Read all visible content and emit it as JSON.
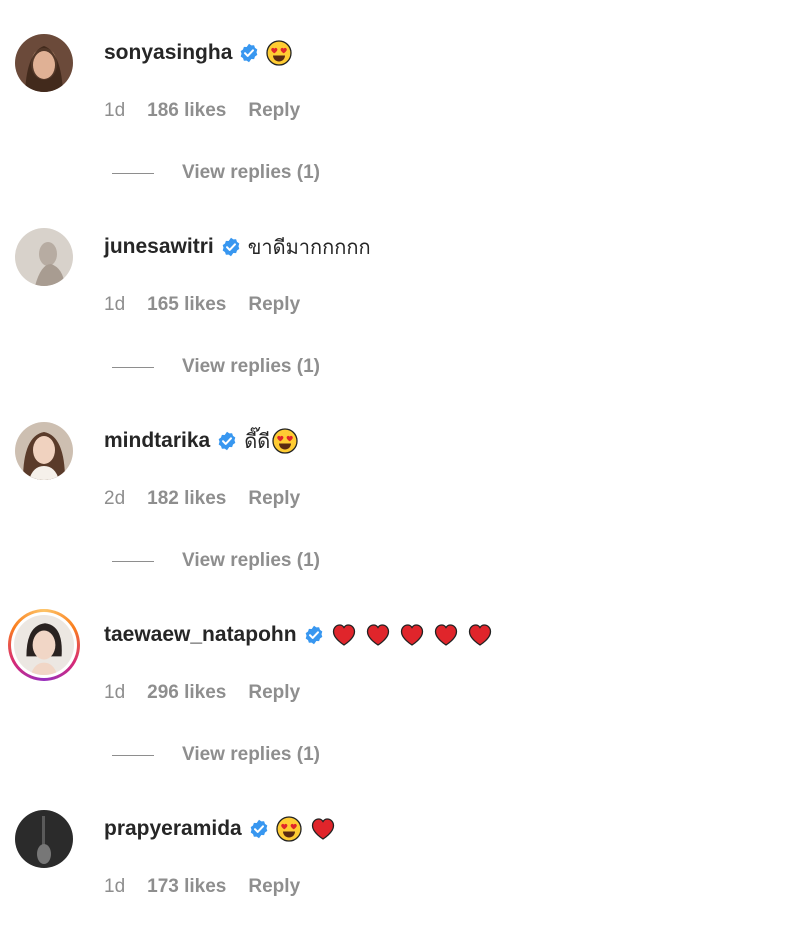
{
  "comments": [
    {
      "username": "sonyasingha",
      "text": "",
      "emojis": [
        "heart-eyes"
      ],
      "age": "1d",
      "likes": "186 likes",
      "reply": "Reply",
      "view_replies": "View replies (1)",
      "avatar_color": "#6b4a3a"
    },
    {
      "username": "junesawitri",
      "text": "ขาดีมากกกกก",
      "emojis": [],
      "age": "1d",
      "likes": "165 likes",
      "reply": "Reply",
      "view_replies": "View replies (1)",
      "avatar_color": "#cfc8c0"
    },
    {
      "username": "mindtarika",
      "text": "ดี๊ดี",
      "emojis": [
        "heart-eyes"
      ],
      "age": "2d",
      "likes": "182 likes",
      "reply": "Reply",
      "view_replies": "View replies (1)",
      "avatar_color": "#c9b8a8"
    },
    {
      "username": "taewaew_natapohn",
      "text": "",
      "emojis": [
        "red-heart",
        "red-heart",
        "red-heart",
        "red-heart",
        "red-heart"
      ],
      "age": "1d",
      "likes": "296 likes",
      "reply": "Reply",
      "view_replies": "View replies (1)",
      "avatar_color": "#e9e3de"
    },
    {
      "username": "prapyeramida",
      "text": "",
      "emojis": [
        "heart-eyes",
        "red-heart"
      ],
      "age": "1d",
      "likes": "173 likes",
      "reply": "Reply",
      "view_replies": "",
      "avatar_color": "#2e2e2e"
    }
  ],
  "colors": {
    "text": "#262626",
    "muted": "#8e8e8e",
    "verified": "#3897f0",
    "heart": "#e0252b"
  }
}
